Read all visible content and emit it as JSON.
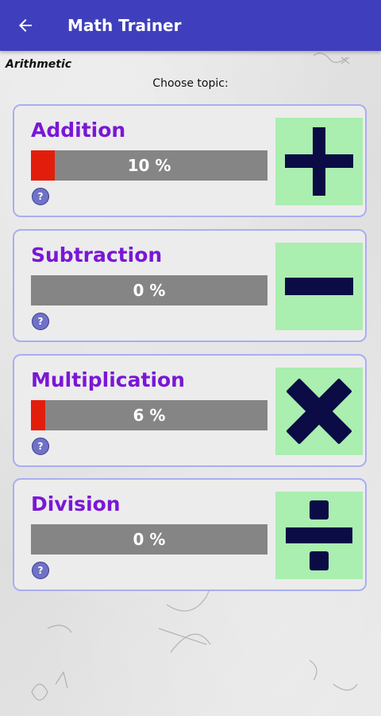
{
  "app_bar": {
    "title": "Math Trainer",
    "back_icon": "arrow-left-icon",
    "background_color": "#3f3fbd"
  },
  "section_label": "Arithmetic",
  "subtitle": "Choose topic:",
  "topics": [
    {
      "name": "Addition",
      "progress_text": "10 %",
      "progress_percent": 10,
      "help_label": "?",
      "icon": "plus-icon"
    },
    {
      "name": "Subtraction",
      "progress_text": "0 %",
      "progress_percent": 0,
      "help_label": "?",
      "icon": "minus-icon"
    },
    {
      "name": "Multiplication",
      "progress_text": "6 %",
      "progress_percent": 6,
      "help_label": "?",
      "icon": "multiply-icon"
    },
    {
      "name": "Division",
      "progress_text": "0 %",
      "progress_percent": 0,
      "help_label": "?",
      "icon": "divide-icon"
    }
  ],
  "colors": {
    "topic_name": "#7a17d6",
    "progress_track": "#858585",
    "progress_fill": "#e31d0c",
    "icon_tile": "#aaeeb0",
    "icon_glyph": "#0b0b45",
    "card_border": "#a9aef2"
  }
}
